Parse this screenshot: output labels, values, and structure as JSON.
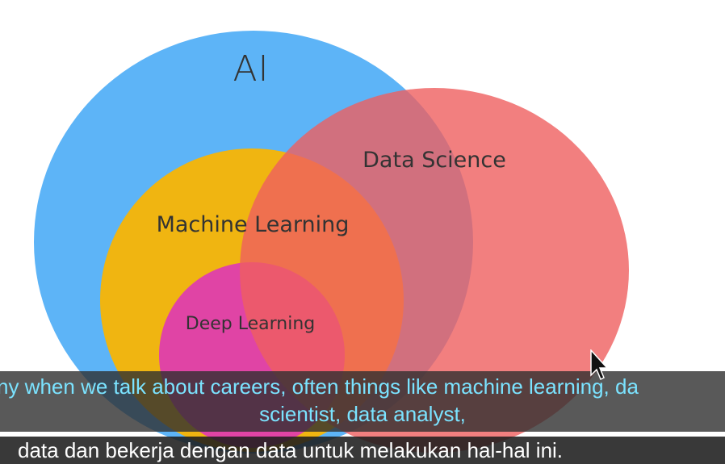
{
  "diagram": {
    "labels": {
      "ai": "AI",
      "data_science": "Data Science",
      "machine_learning": "Machine Learning",
      "deep_learning": "Deep Learning"
    },
    "colors": {
      "ai": "#5db4f7",
      "machine_learning": "#f0b511",
      "deep_learning": "#e044a5",
      "data_science": "#ef5f5f"
    }
  },
  "subtitles": {
    "english_line_1": "ny when we talk about careers, often things like machine learning, da",
    "english_line_2": "scientist, data analyst,",
    "indonesian_line": "data dan bekerja dengan data untuk melakukan hal-hal ini."
  }
}
